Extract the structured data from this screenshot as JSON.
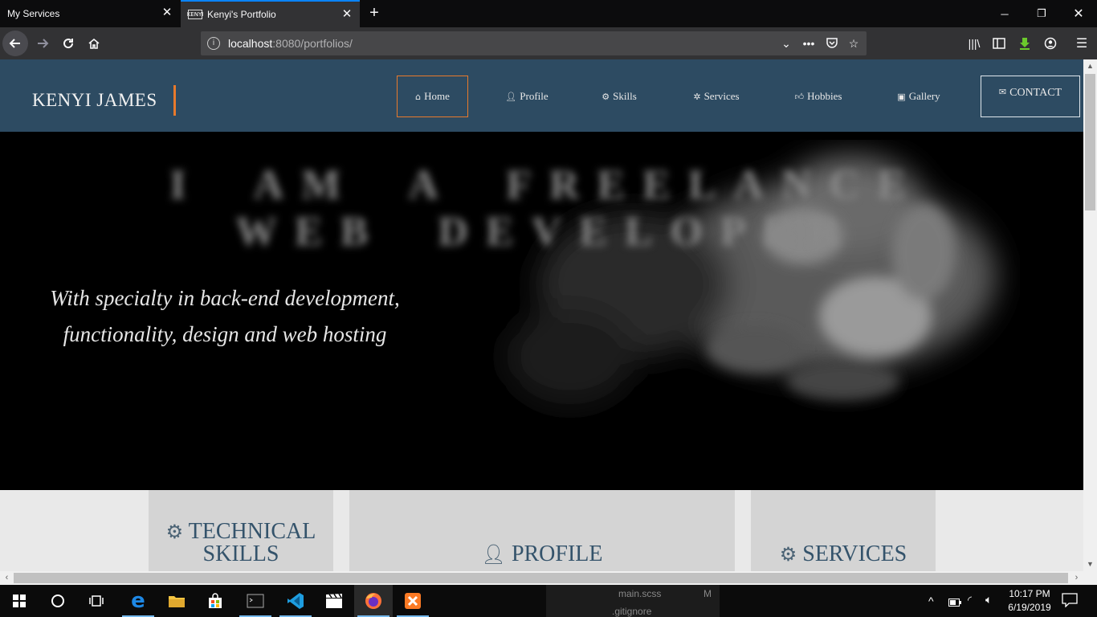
{
  "browser": {
    "tabs": [
      {
        "title": "My Services",
        "active": false
      },
      {
        "title": "Kenyi's Portfolio",
        "active": true,
        "favicon_text": "KENYI"
      }
    ],
    "url_host": "localhost",
    "url_rest": ":8080/portfolios/",
    "accent": "#0a84ff"
  },
  "site": {
    "brand": "KENYI JAMES",
    "brand_accent": "#e87a2c",
    "nav_bg": "#2d4b62",
    "nav": [
      {
        "label": "Home",
        "icon": "home-icon"
      },
      {
        "label": "Profile",
        "icon": "user-icon"
      },
      {
        "label": "Skills",
        "icon": "cogs-icon"
      },
      {
        "label": "Services",
        "icon": "cog-icon"
      },
      {
        "label": "Hobbies",
        "icon": "thumbs-up-icon"
      },
      {
        "label": "Gallery",
        "icon": "image-icon"
      }
    ],
    "contact_label": "CONTACT",
    "hero": {
      "headline": "I AM A FREELANCE WEB DEVELOPER",
      "specialty_line1": "With specialty in back-end development,",
      "specialty_line2": "functionality, design and web hosting"
    },
    "cards": {
      "technical_skills_line1": "TECHNICAL",
      "technical_skills_line2": "SKILLS",
      "profile": "PROFILE",
      "services": "SERVICES"
    }
  },
  "taskbar": {
    "time": "10:17 PM",
    "date": "6/19/2019",
    "ghost_file1": "main.scss",
    "ghost_file1_status": "M",
    "ghost_file2": ".gitignore"
  }
}
